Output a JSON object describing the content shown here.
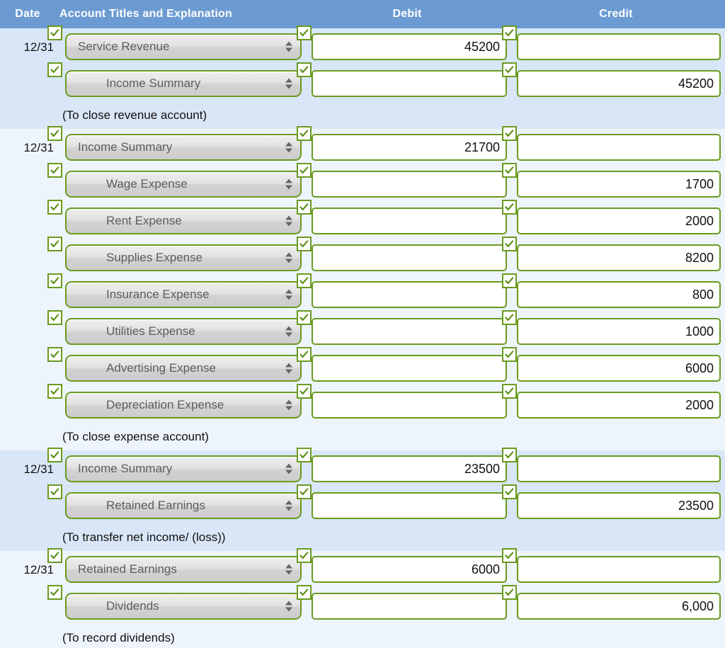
{
  "header": {
    "date": "Date",
    "account": "Account Titles and Explanation",
    "debit": "Debit",
    "credit": "Credit"
  },
  "colors": {
    "header_bg": "#6b9bd2",
    "header_text": "#ffffff",
    "band_dark": "#d9e6f7",
    "band_light": "#eef4fc",
    "field_border": "#6a9a1f",
    "select_text": "#5d5d5d",
    "value_text": "#111111"
  },
  "icons": {
    "check": "check-icon",
    "spinner_up": "triangle-up-icon",
    "spinner_down": "triangle-down-icon"
  },
  "entries": [
    {
      "date": "12/31",
      "lines": [
        {
          "account": "Service Revenue",
          "indent": false,
          "debit": "45200",
          "credit": ""
        },
        {
          "account": "Income Summary",
          "indent": true,
          "debit": "",
          "credit": "45200"
        }
      ],
      "explanation": "(To close revenue account)"
    },
    {
      "date": "12/31",
      "lines": [
        {
          "account": "Income Summary",
          "indent": false,
          "debit": "21700",
          "credit": ""
        },
        {
          "account": "Wage Expense",
          "indent": true,
          "debit": "",
          "credit": "1700"
        },
        {
          "account": "Rent Expense",
          "indent": true,
          "debit": "",
          "credit": "2000"
        },
        {
          "account": "Supplies Expense",
          "indent": true,
          "debit": "",
          "credit": "8200"
        },
        {
          "account": "Insurance Expense",
          "indent": true,
          "debit": "",
          "credit": "800"
        },
        {
          "account": "Utilities Expense",
          "indent": true,
          "debit": "",
          "credit": "1000"
        },
        {
          "account": "Advertising Expense",
          "indent": true,
          "debit": "",
          "credit": "6000"
        },
        {
          "account": "Depreciation Expense",
          "indent": true,
          "debit": "",
          "credit": "2000"
        }
      ],
      "explanation": "(To close expense account)"
    },
    {
      "date": "12/31",
      "lines": [
        {
          "account": "Income Summary",
          "indent": false,
          "debit": "23500",
          "credit": ""
        },
        {
          "account": "Retained Earnings",
          "indent": true,
          "debit": "",
          "credit": "23500"
        }
      ],
      "explanation": "(To transfer net income/ (loss))"
    },
    {
      "date": "12/31",
      "lines": [
        {
          "account": "Retained Earnings",
          "indent": false,
          "debit": "6000",
          "credit": ""
        },
        {
          "account": "Dividends",
          "indent": true,
          "debit": "",
          "credit": "6,000"
        }
      ],
      "explanation": "(To record dividends)"
    }
  ]
}
